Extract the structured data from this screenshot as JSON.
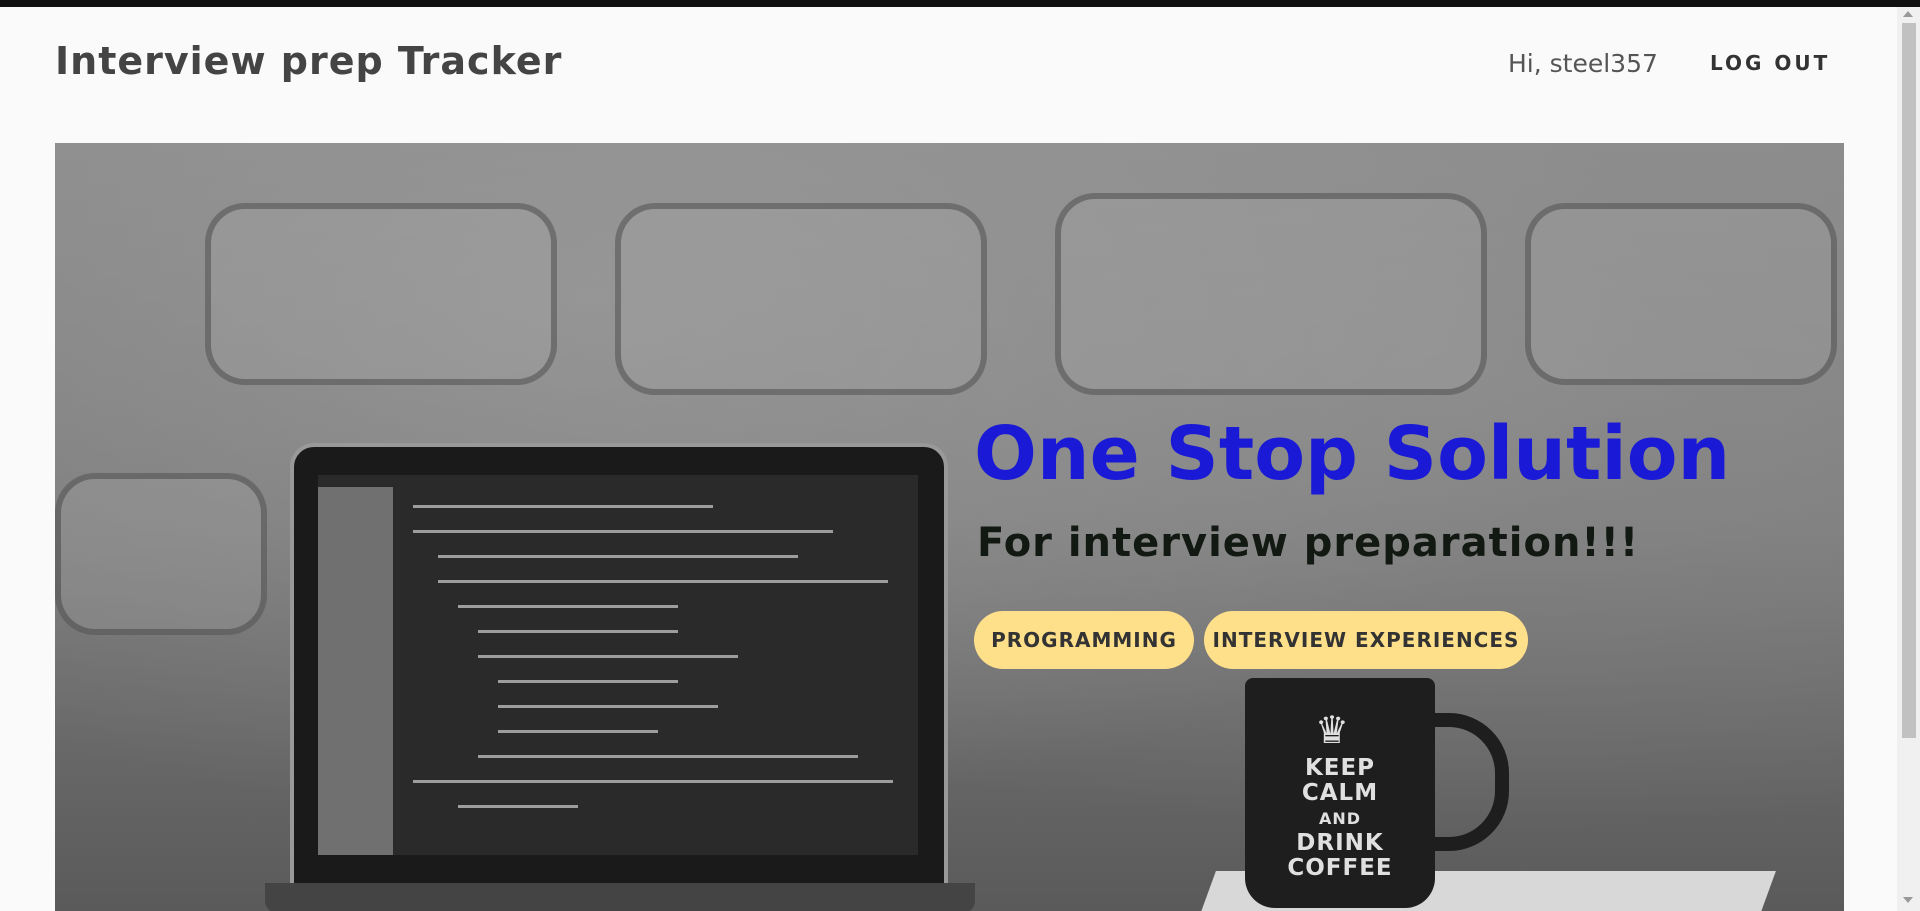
{
  "header": {
    "brand": "Interview prep Tracker",
    "greeting": "Hi, steel357",
    "logout_label": "LOG OUT"
  },
  "hero": {
    "title": "One Stop Solution",
    "subtitle": "For interview preparation!!!",
    "buttons": [
      {
        "label": "PROGRAMMING"
      },
      {
        "label": "INTERVIEW EXPERIENCES"
      }
    ],
    "mug_text": [
      "KEEP",
      "CALM",
      "AND",
      "DRINK",
      "COFFEE"
    ]
  },
  "colors": {
    "title": "#1a1ad6",
    "button_bg": "#ffe08a",
    "page_bg": "#fafafa"
  }
}
